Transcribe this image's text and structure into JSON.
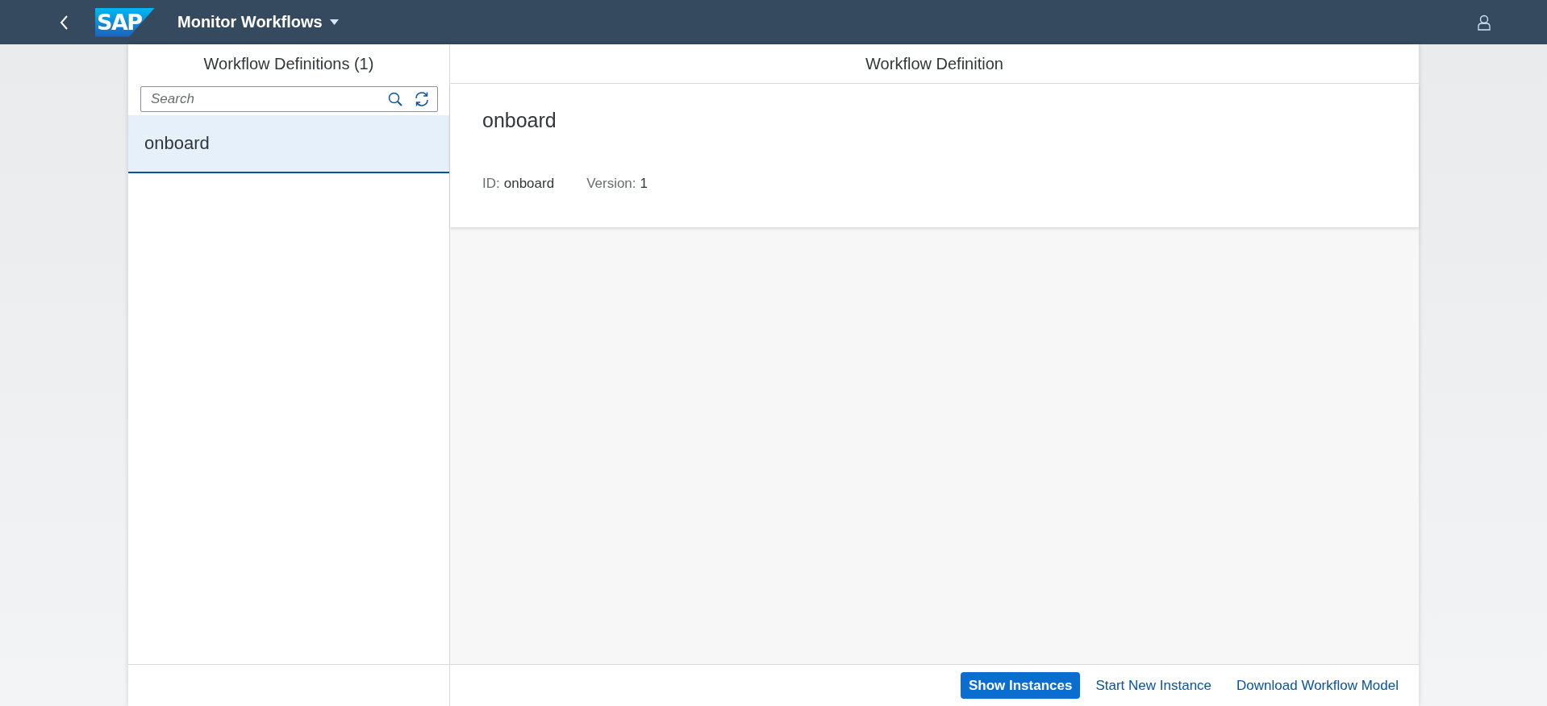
{
  "shell_bar": {
    "logo_text": "SAP",
    "title": "Monitor Workflows"
  },
  "master": {
    "title": "Workflow Definitions (1)",
    "search": {
      "placeholder": "Search"
    },
    "items": [
      {
        "label": "onboard",
        "selected": true
      }
    ]
  },
  "detail": {
    "title": "Workflow Definition",
    "object_header": {
      "title": "onboard",
      "attributes": [
        {
          "label": "ID:",
          "value": "onboard"
        },
        {
          "label": "Version:",
          "value": "1"
        }
      ]
    }
  },
  "footer": {
    "actions": [
      {
        "label": "Show Instances",
        "kind": "emphasized"
      },
      {
        "label": "Start New Instance",
        "kind": "transparent"
      },
      {
        "label": "Download Workflow Model",
        "kind": "transparent"
      }
    ]
  }
}
